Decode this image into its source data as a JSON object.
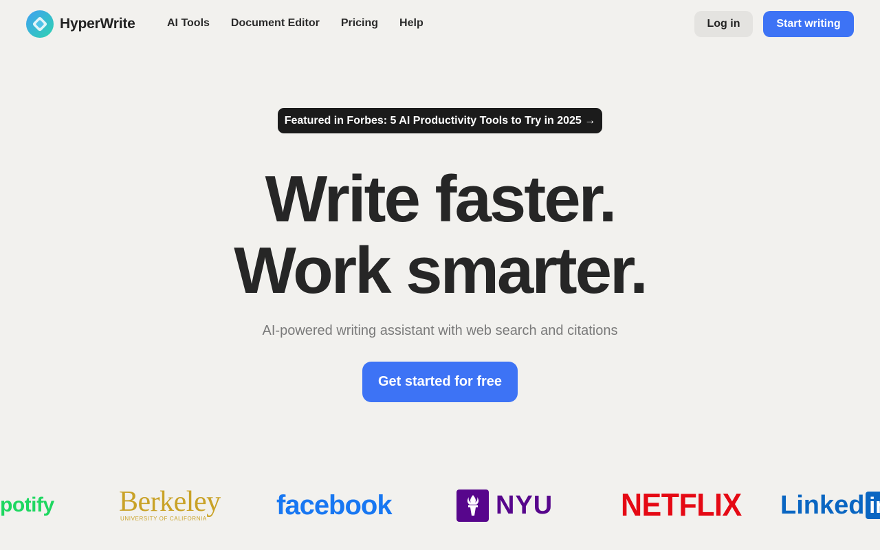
{
  "nav": {
    "brand": "HyperWrite",
    "links": [
      "AI Tools",
      "Document Editor",
      "Pricing",
      "Help"
    ],
    "login_label": "Log in",
    "start_label": "Start writing"
  },
  "hero": {
    "badge": "Featured in Forbes: 5 AI Productivity Tools to Try in 2025 →",
    "headline_line1": "Write faster.",
    "headline_line2": "Work smarter.",
    "subhead": "AI-powered writing assistant with web search and citations",
    "cta_label": "Get started for free"
  },
  "logos": {
    "spotify": "potify",
    "berkeley": "Berkeley",
    "berkeley_sub": "UNIVERSITY OF CALIFORNIA",
    "facebook": "facebook",
    "nyu": "NYU",
    "netflix": "NETFLIX",
    "linkedin": "Linked",
    "linkedin_box": "in"
  },
  "colors": {
    "background": "#f2f1ee",
    "accent": "#3d73f5",
    "badge_bg": "#1b1b1b"
  },
  "icons": {
    "brand_logo": "hyperwrite-logo-icon",
    "nyu_torch": "nyu-torch-icon"
  }
}
